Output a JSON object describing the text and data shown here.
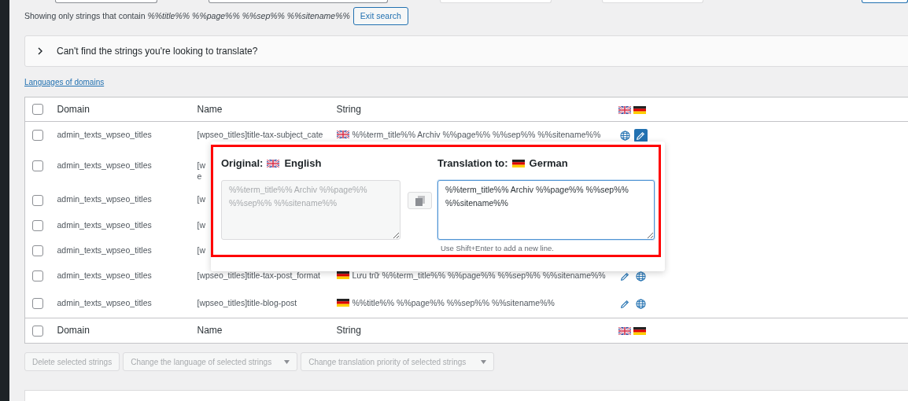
{
  "search_note": "Showing only strings that contain *%%title%% %%page%% %%sep%% %%sitename%%*",
  "exit_button": "Exit search",
  "collapsible": {
    "label": "Can't find the strings you're looking to translate?",
    "expanded": false
  },
  "languages_link": "Languages of domains",
  "table": {
    "select_all_checked": false,
    "footer_select_all_checked": false,
    "columns": [
      "Domain",
      "Name",
      "String"
    ],
    "column_flags": [
      {
        "kind": "en"
      },
      {
        "kind": "de"
      }
    ],
    "rows": [
      {
        "checked": false,
        "domain": "admin_texts_wpseo_titles",
        "name_lines": [
          "[wpseo_titles]title-tax-subject_cate"
        ],
        "string_flag": {
          "kind": "en"
        },
        "string": "%%term_title%% Archiv %%page%% %%sep%% %%sitename%%",
        "actions": [
          {
            "kind": "globe",
            "active": false
          },
          {
            "kind": "pencil",
            "active": true
          }
        ]
      },
      {
        "checked": false,
        "domain": "admin_texts_wpseo_titles",
        "name_lines": [
          "[w",
          "e"
        ]
      },
      {
        "checked": false,
        "domain": "admin_texts_wpseo_titles",
        "name_lines": [
          "[w"
        ]
      },
      {
        "checked": false,
        "domain": "admin_texts_wpseo_titles",
        "name_lines": [
          "[w"
        ]
      },
      {
        "checked": false,
        "domain": "admin_texts_wpseo_titles",
        "name_lines": [
          "[w"
        ]
      },
      {
        "checked": false,
        "domain": "admin_texts_wpseo_titles",
        "name_lines": [
          "[wpseo_titles]title-tax-post_format"
        ],
        "string_flag": {
          "kind": "de"
        },
        "string": "Lưu trữ %%term_title%% %%page%% %%sep%% %%sitename%%",
        "actions": [
          {
            "kind": "pencil",
            "active": false
          },
          {
            "kind": "globe",
            "active": false
          }
        ]
      },
      {
        "checked": false,
        "domain": "admin_texts_wpseo_titles",
        "name_lines": [
          "[wpseo_titles]title-blog-post"
        ],
        "string_flag": {
          "kind": "de"
        },
        "string": "%%title%% %%page%% %%sep%% %%sitename%%",
        "actions": [
          {
            "kind": "pencil",
            "active": false
          },
          {
            "kind": "globe",
            "active": false
          }
        ]
      }
    ],
    "footer_columns": [
      "Domain",
      "Name",
      "String"
    ],
    "footer_flags": [
      {
        "kind": "en"
      },
      {
        "kind": "de"
      }
    ]
  },
  "popup": {
    "original_label": "Original:",
    "original_flag": {
      "kind": "en"
    },
    "original_language": "English",
    "original_text": "%%term_title%% Archiv %%page%% %%sep%% %%sitename%%",
    "translation_label": "Translation to:",
    "translation_flag": {
      "kind": "de"
    },
    "translation_language": "German",
    "translation_text": "%%term_title%% Archiv %%page%% %%sep%% %%sitename%%",
    "hint": "Use Shift+Enter to add a new line."
  },
  "bulk_actions": [
    {
      "kind": "button",
      "label": "Delete selected strings",
      "disabled": true
    },
    {
      "kind": "select",
      "label": "Change the language of selected strings",
      "disabled": true
    },
    {
      "kind": "select",
      "label": "Change translation priority of selected strings",
      "disabled": true
    }
  ]
}
